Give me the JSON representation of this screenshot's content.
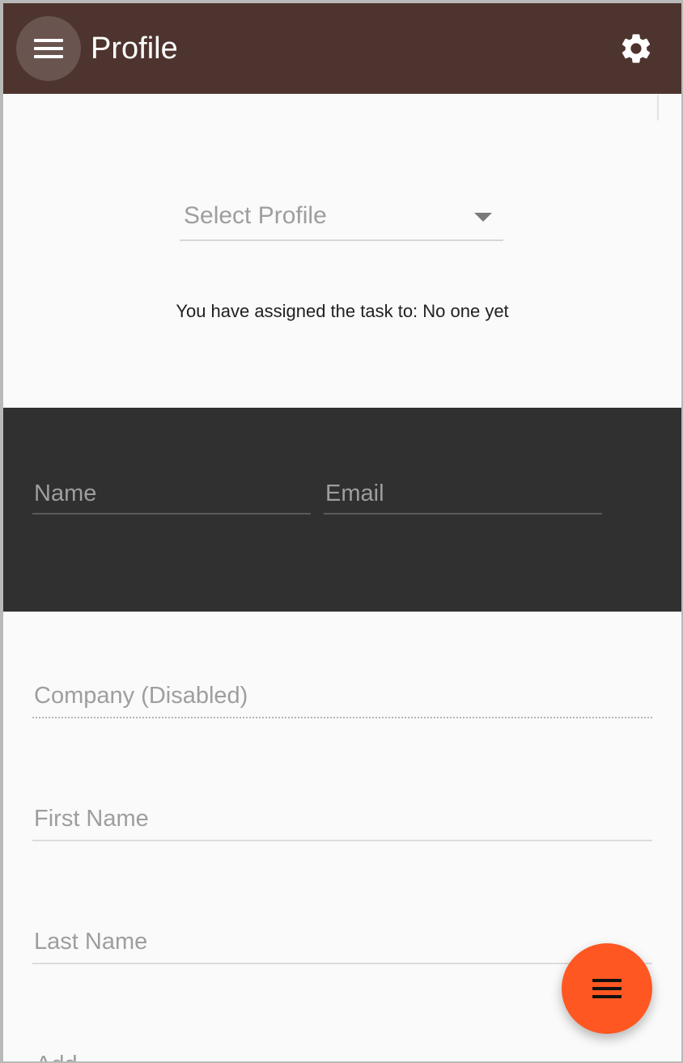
{
  "toolbar": {
    "title": "Profile",
    "menu_icon": "menu-icon",
    "settings_icon": "gear-icon",
    "color": "#4e342e"
  },
  "profile_select": {
    "placeholder": "Select Profile",
    "icon": "dropdown-arrow-icon"
  },
  "assignment": {
    "text": "You have assigned the task to: No one yet"
  },
  "dark_section": {
    "color": "#303030",
    "name_placeholder": "Name",
    "email_placeholder": "Email"
  },
  "form": {
    "company_placeholder": "Company (Disabled)",
    "first_name_placeholder": "First Name",
    "last_name_placeholder": "Last Name",
    "cut_off_label": "Add"
  },
  "fab": {
    "icon": "menu-icon",
    "color": "#ff5722"
  }
}
